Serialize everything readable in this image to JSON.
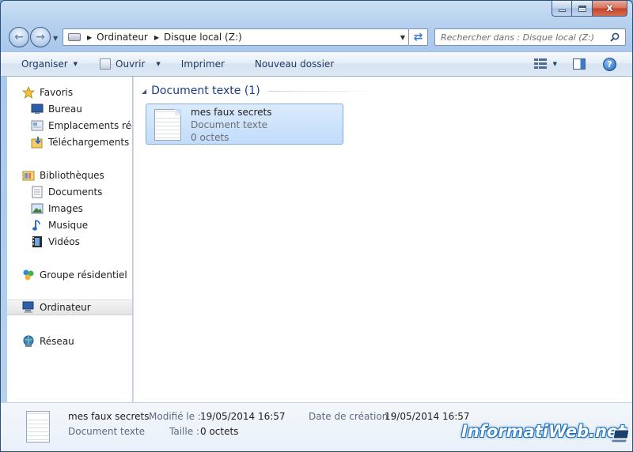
{
  "window": {
    "caption_close": "x"
  },
  "address_bar": {
    "crumbs": [
      "Ordinateur",
      "Disque local (Z:)"
    ]
  },
  "search": {
    "placeholder": "Rechercher dans : Disque local (Z:)"
  },
  "toolbar": {
    "organiser": "Organiser",
    "ouvrir": "Ouvrir",
    "imprimer": "Imprimer",
    "nouveau_dossier": "Nouveau dossier",
    "help": "?"
  },
  "navigation": {
    "items": [
      {
        "label": "Favoris",
        "icon": "star-icon"
      },
      {
        "label": "Bureau",
        "icon": "desktop-icon"
      },
      {
        "label": "Emplacements récents",
        "icon": "recent-places-icon"
      },
      {
        "label": "Téléchargements",
        "icon": "downloads-icon"
      },
      {
        "label": "Bibliothèques",
        "icon": "libraries-icon"
      },
      {
        "label": "Documents",
        "icon": "documents-icon"
      },
      {
        "label": "Images",
        "icon": "images-icon"
      },
      {
        "label": "Musique",
        "icon": "music-icon"
      },
      {
        "label": "Vidéos",
        "icon": "videos-icon"
      },
      {
        "label": "Groupe résidentiel",
        "icon": "homegroup-icon"
      },
      {
        "label": "Ordinateur",
        "icon": "computer-icon"
      },
      {
        "label": "Réseau",
        "icon": "network-icon"
      }
    ]
  },
  "content": {
    "group_title": "Document texte (1)",
    "file": {
      "name": "mes faux secrets",
      "type": "Document texte",
      "size": "0 octets"
    }
  },
  "details": {
    "name": "mes faux secrets",
    "type": "Document texte",
    "modified_label": "Modifié le :",
    "modified_value": "19/05/2014 16:57",
    "size_label": "Taille :",
    "size_value": "0 octets",
    "created_label": "Date de création :",
    "created_value": "19/05/2014 16:57"
  },
  "watermark": {
    "text": "InformatiWeb.net"
  },
  "colors": {
    "selection_fill": "#c1dcfc",
    "selection_border": "#84acdd",
    "group_title": "#1e3a8a",
    "toolbar_text": "#1e3a5f"
  }
}
